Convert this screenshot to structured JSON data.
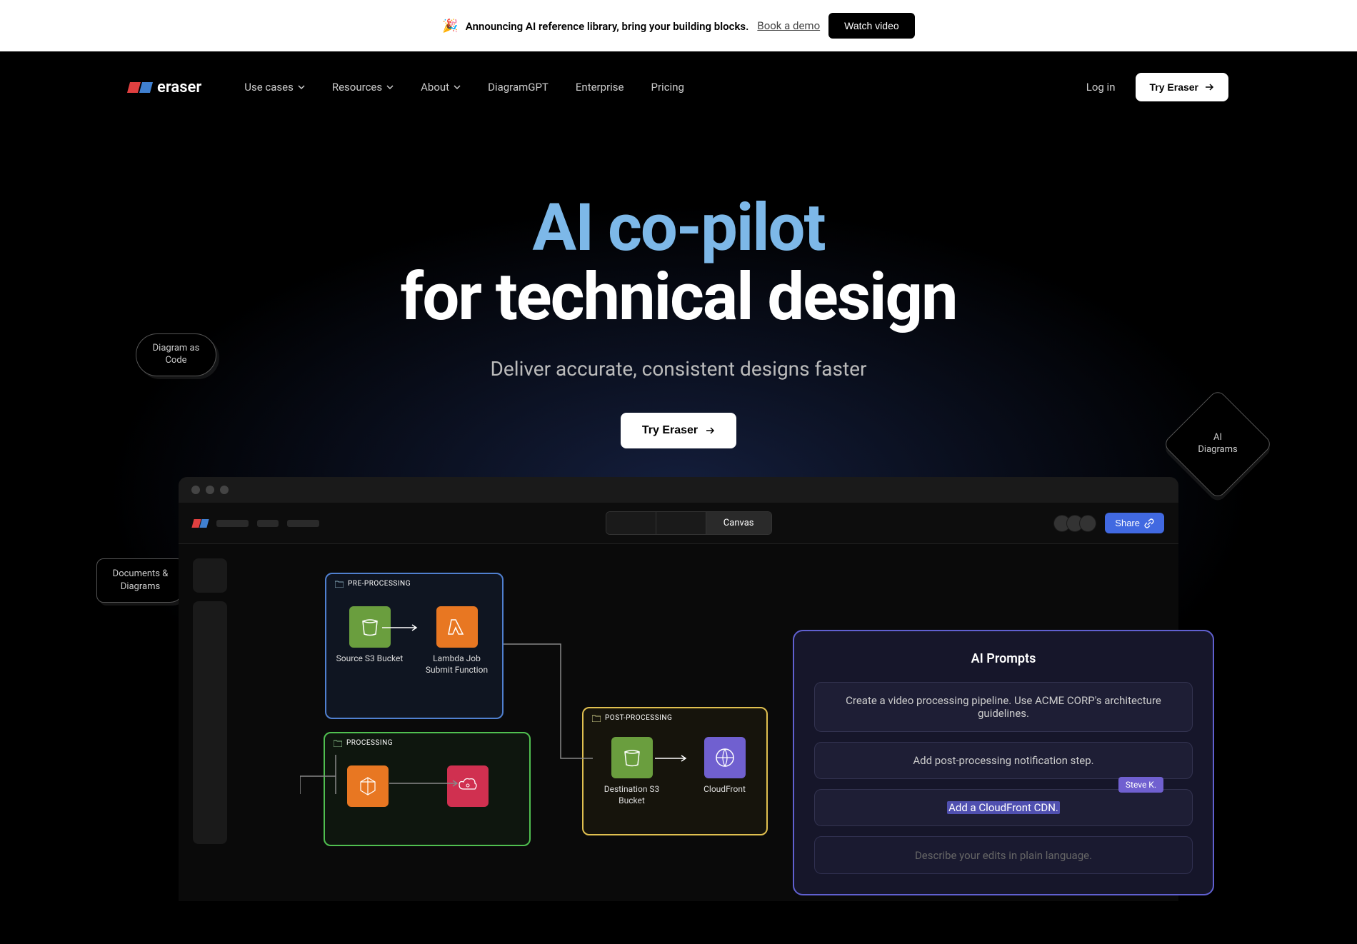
{
  "announcement": {
    "emoji": "🎉",
    "text": "Announcing AI reference library, bring your building blocks.",
    "book_demo": "Book a demo",
    "watch_video": "Watch video"
  },
  "nav": {
    "logo_text": "eraser",
    "items": [
      "Use cases",
      "Resources",
      "About",
      "DiagramGPT",
      "Enterprise",
      "Pricing"
    ],
    "login": "Log in",
    "try_eraser": "Try Eraser"
  },
  "hero": {
    "title_line1": "AI co-pilot",
    "title_line2": "for technical design",
    "subtitle": "Deliver accurate, consistent designs faster",
    "cta": "Try Eraser"
  },
  "badges": {
    "diagram_code": "Diagram as Code",
    "ai_diagrams": "AI Diagrams",
    "docs_diagrams": "Documents & Diagrams"
  },
  "app": {
    "canvas_tab": "Canvas",
    "share": "Share",
    "groups": {
      "preprocessing": "PRE-PROCESSING",
      "processing": "PROCESSING",
      "postprocessing": "POST-PROCESSING"
    },
    "nodes": {
      "s3_source": "Source S3 Bucket",
      "lambda": "Lambda Job Submit Function",
      "s3_dest": "Destination S3 Bucket",
      "cloudfront": "CloudFront"
    }
  },
  "ai_panel": {
    "title": "AI Prompts",
    "prompts": [
      "Create a video processing pipeline. Use ACME CORP's architecture guidelines.",
      "Add post-processing notification step.",
      "Add a CloudFront CDN."
    ],
    "steve_tag": "Steve K.",
    "placeholder": "Describe your edits in plain language."
  },
  "colors": {
    "logo_red": "#e04040",
    "logo_blue": "#4080d0",
    "accent_blue": "#7db8e8",
    "green": "#6a9e3e",
    "orange": "#e87722",
    "yellow": "#d4a017",
    "purple": "#7060d0"
  }
}
